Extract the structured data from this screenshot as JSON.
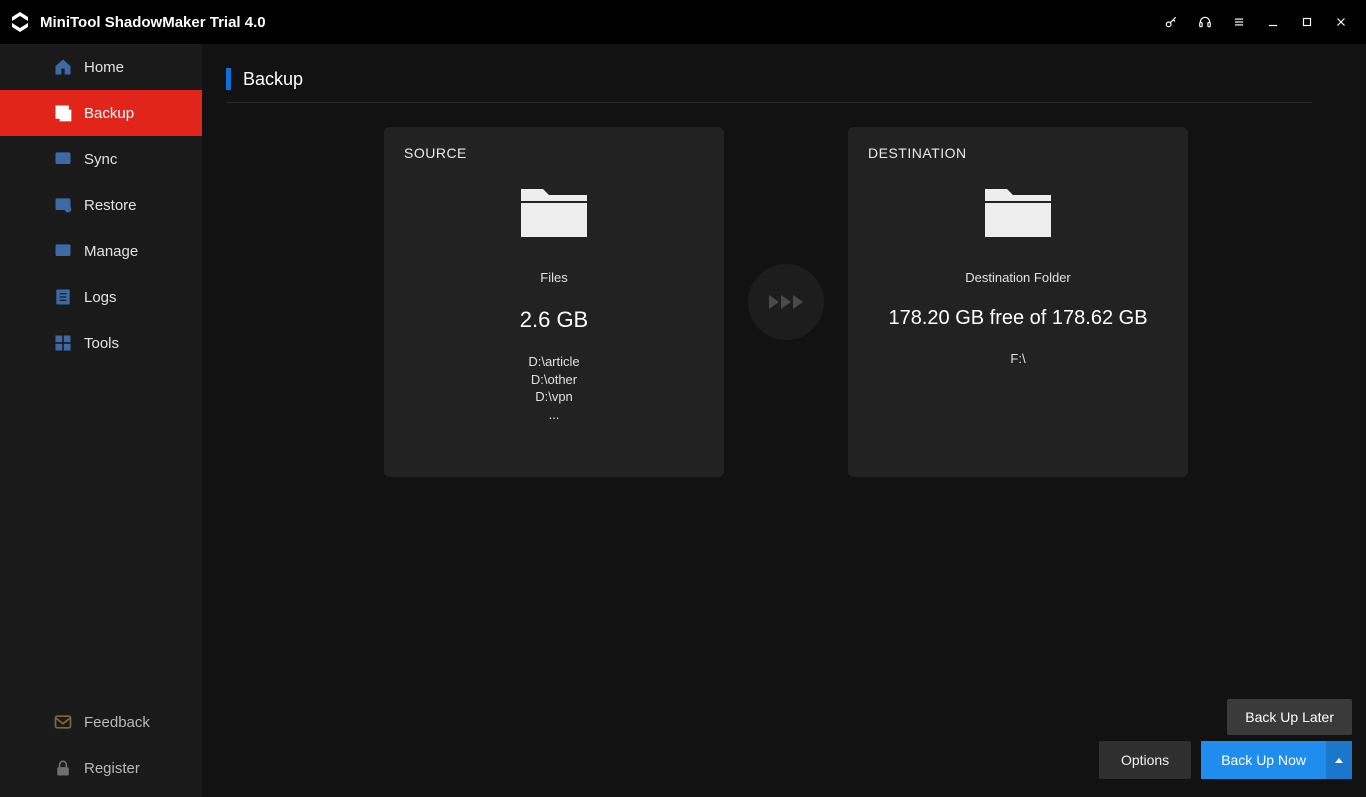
{
  "app": {
    "title": "MiniTool ShadowMaker Trial 4.0"
  },
  "sidebar": {
    "items": [
      {
        "label": "Home"
      },
      {
        "label": "Backup"
      },
      {
        "label": "Sync"
      },
      {
        "label": "Restore"
      },
      {
        "label": "Manage"
      },
      {
        "label": "Logs"
      },
      {
        "label": "Tools"
      }
    ],
    "bottom": [
      {
        "label": "Feedback"
      },
      {
        "label": "Register"
      }
    ]
  },
  "page": {
    "title": "Backup"
  },
  "source": {
    "heading": "SOURCE",
    "type_label": "Files",
    "size": "2.6 GB",
    "paths": [
      "D:\\article",
      "D:\\other",
      "D:\\vpn",
      "..."
    ]
  },
  "destination": {
    "heading": "DESTINATION",
    "type_label": "Destination Folder",
    "free_text": "178.20 GB free of 178.62 GB",
    "path": "F:\\"
  },
  "actions": {
    "options": "Options",
    "backup_now": "Back Up Now",
    "backup_later": "Back Up Later"
  }
}
